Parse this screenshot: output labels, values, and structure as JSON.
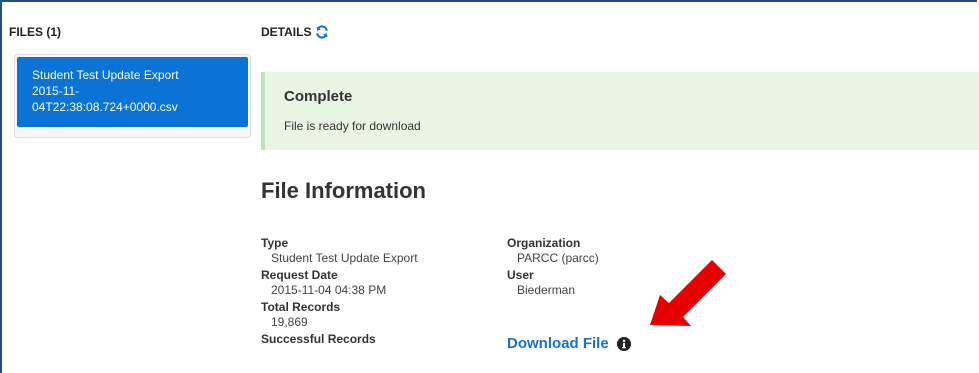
{
  "files": {
    "heading": "FILES (1)",
    "items": [
      {
        "line1": "Student Test Update Export",
        "line2": "2015-11-",
        "line3": "04T22:38:08.724+0000.csv"
      }
    ]
  },
  "details": {
    "heading": "DETAILS",
    "alert": {
      "title": "Complete",
      "text": "File is ready for download"
    },
    "section_title": "File Information",
    "left": [
      {
        "label": "Type",
        "value": "Student Test Update Export"
      },
      {
        "label": "Request Date",
        "value": "2015-11-04 04:38 PM"
      },
      {
        "label": "Total Records",
        "value": "19,869"
      },
      {
        "label": "Successful Records",
        "value": ""
      }
    ],
    "right": [
      {
        "label": "Organization",
        "value": "PARCC (parcc)"
      },
      {
        "label": "User",
        "value": "Biederman"
      }
    ],
    "download_label": "Download File"
  },
  "colors": {
    "selected_blue": "#0b72d6",
    "link_blue": "#1a73c4",
    "alert_bg": "#e9f6e6",
    "arrow_red": "#e60000",
    "frame_blue": "#1f4e8c"
  }
}
